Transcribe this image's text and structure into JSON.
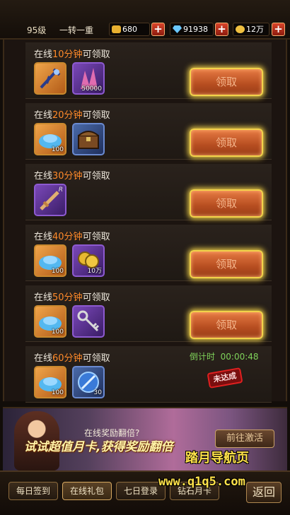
{
  "player": {
    "level": "95级",
    "rank": "一转一重"
  },
  "resources": [
    {
      "name": "gold",
      "value": "680",
      "color": "#e8b030",
      "icon": "gold-ingot-icon"
    },
    {
      "name": "diamond",
      "value": "91938",
      "color": "#6ac8ff",
      "icon": "diamond-icon"
    },
    {
      "name": "coins",
      "value": "12万",
      "color": "#f0c040",
      "icon": "coin-icon"
    }
  ],
  "rewards": [
    {
      "title_prefix": "在线",
      "minutes": "10分钟",
      "title_suffix": "可领取",
      "items": [
        {
          "kind": "weapon",
          "style": "orange",
          "qty": ""
        },
        {
          "kind": "crystal",
          "style": "purple",
          "qty": "50000"
        }
      ],
      "button": "领取",
      "state": "claimable"
    },
    {
      "title_prefix": "在线",
      "minutes": "20分钟",
      "title_suffix": "可领取",
      "items": [
        {
          "kind": "blue-crystals",
          "style": "orange",
          "qty": "100"
        },
        {
          "kind": "treasure-chest",
          "style": "blue",
          "qty": ""
        }
      ],
      "button": "领取",
      "state": "claimable"
    },
    {
      "title_prefix": "在线",
      "minutes": "30分钟",
      "title_suffix": "可领取",
      "items": [
        {
          "kind": "sword",
          "style": "purple",
          "qty": "",
          "rarity": "R"
        }
      ],
      "button": "领取",
      "state": "claimable"
    },
    {
      "title_prefix": "在线",
      "minutes": "40分钟",
      "title_suffix": "可领取",
      "items": [
        {
          "kind": "blue-crystals",
          "style": "orange",
          "qty": "100"
        },
        {
          "kind": "coins",
          "style": "purple",
          "qty": "10万"
        }
      ],
      "button": "领取",
      "state": "claimable"
    },
    {
      "title_prefix": "在线",
      "minutes": "50分钟",
      "title_suffix": "可领取",
      "items": [
        {
          "kind": "blue-crystals",
          "style": "orange",
          "qty": "100"
        },
        {
          "kind": "key",
          "style": "purple",
          "qty": ""
        }
      ],
      "button": "领取",
      "state": "claimable"
    },
    {
      "title_prefix": "在线",
      "minutes": "60分钟",
      "title_suffix": "可领取",
      "items": [
        {
          "kind": "blue-crystals",
          "style": "orange",
          "qty": "100"
        },
        {
          "kind": "orb",
          "style": "blue",
          "qty": "30"
        }
      ],
      "countdown_label": "倒计时",
      "countdown": "00:00:48",
      "stamp": "未达成",
      "state": "locked"
    }
  ],
  "banner": {
    "title": "在线奖励翻倍?",
    "slogan": "试试超值月卡,获得奖励翻倍",
    "button": "前往激活"
  },
  "watermark": {
    "line1": "踏月导航页",
    "line2": "www.q1q5.com"
  },
  "nav": {
    "tabs": [
      {
        "label": "每日签到",
        "active": false
      },
      {
        "label": "在线礼包",
        "active": true
      },
      {
        "label": "七日登录",
        "active": false
      },
      {
        "label": "钻石月卡",
        "active": false
      }
    ],
    "back": "返回"
  }
}
